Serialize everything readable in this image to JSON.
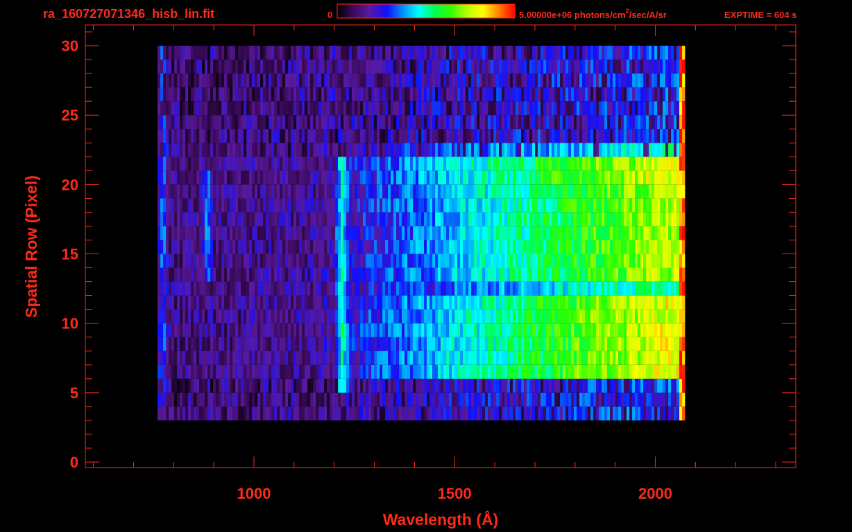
{
  "header": {
    "filename": "ra_160727071346_hisb_lin.fit",
    "colorbar_min": "0",
    "colorbar_max_prefix": "5.00000e+06 photons/cm",
    "colorbar_max_sup": "2",
    "colorbar_max_suffix": "/sec/A/sr",
    "exptime": "EXPTIME = 604 s"
  },
  "colors": {
    "label": "#ff2a1a",
    "background": "#000000",
    "colormap": [
      "#000000",
      "#3a0a5a",
      "#5a1aa0",
      "#1010ff",
      "#00a0ff",
      "#00ffff",
      "#00ff50",
      "#30ff00",
      "#c0ff00",
      "#ffff00",
      "#ff8000",
      "#ff0000"
    ]
  },
  "chart_data": {
    "type": "heatmap",
    "xlabel": "Wavelength (Å)",
    "ylabel": "Spatial Row (Pixel)",
    "xlim": [
      580,
      2350
    ],
    "ylim": [
      -0.4,
      31.5
    ],
    "xticks": [
      1000,
      1500,
      2000
    ],
    "xtick_labels": [
      "1000",
      "1500",
      "2000"
    ],
    "yticks": [
      0,
      5,
      10,
      15,
      20,
      25,
      30
    ],
    "ytick_labels": [
      "0",
      "5",
      "10",
      "15",
      "20",
      "25",
      "30"
    ],
    "colorbar": {
      "min": 0,
      "max": 5000000,
      "units": "photons/cm^2/sec/A/sr"
    },
    "data_extent": {
      "x": [
        760,
        2070
      ],
      "rows": [
        3,
        30
      ]
    },
    "bright_region_rows": [
      6,
      22
    ],
    "emission_features": [
      {
        "wavelength": 1216,
        "rows": [
          5,
          22
        ]
      },
      {
        "wavelength": 880,
        "rows": [
          13,
          21
        ]
      },
      {
        "wavelength": 770,
        "rows": [
          4,
          30
        ]
      }
    ],
    "row_profile": [
      {
        "rows": [
          0,
          3
        ],
        "level": 0.0
      },
      {
        "rows": [
          3,
          6
        ],
        "level": 0.15
      },
      {
        "rows": [
          6,
          12
        ],
        "level": 0.95
      },
      {
        "rows": [
          12,
          13
        ],
        "level": 0.55
      },
      {
        "rows": [
          13,
          20
        ],
        "level": 0.85
      },
      {
        "rows": [
          20,
          22
        ],
        "level": 0.95
      },
      {
        "rows": [
          22,
          23
        ],
        "level": 0.45
      },
      {
        "rows": [
          23,
          30
        ],
        "level": 0.12
      }
    ]
  }
}
